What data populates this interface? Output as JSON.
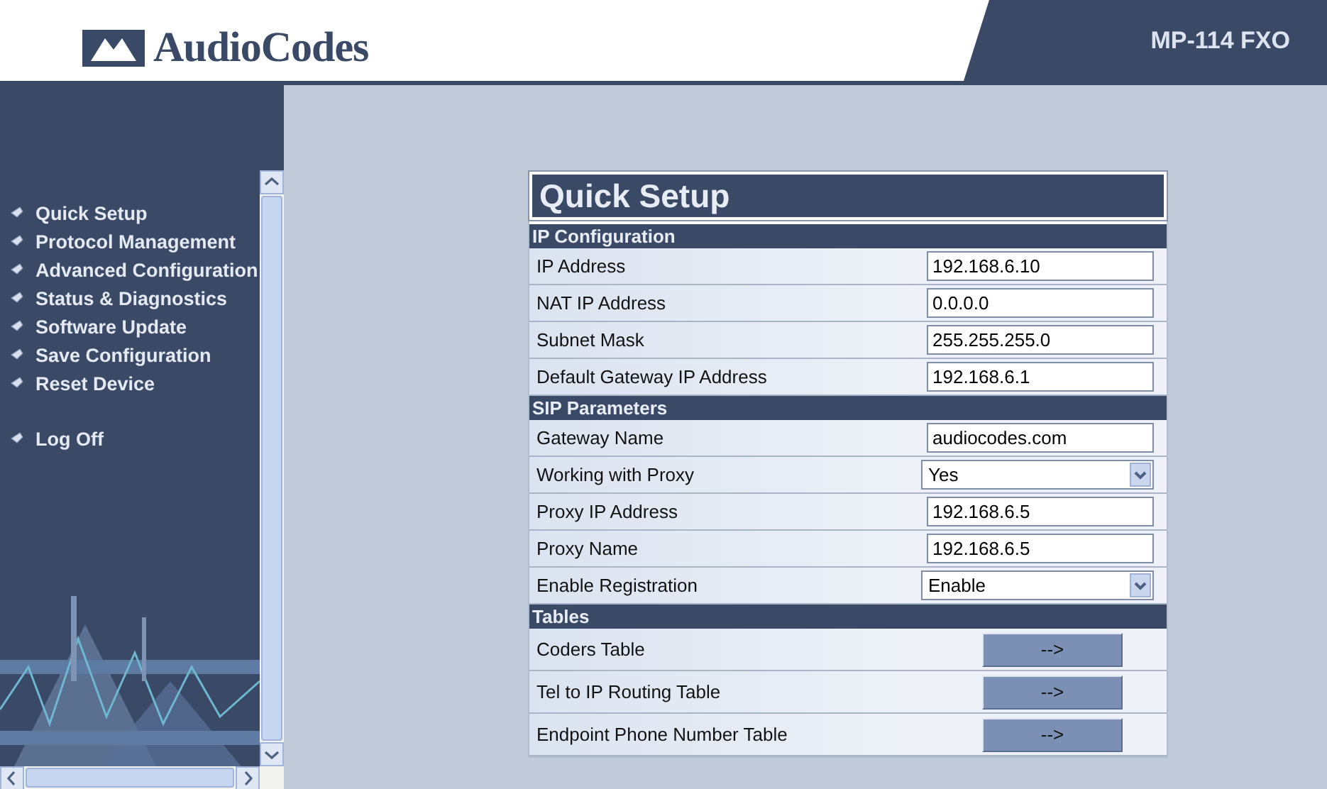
{
  "header": {
    "logo_text": "AudioCodes",
    "product": "MP-114 FXO"
  },
  "menu": [
    {
      "label": "Quick Setup"
    },
    {
      "label": "Protocol Management"
    },
    {
      "label": "Advanced Configuration"
    },
    {
      "label": "Status & Diagnostics"
    },
    {
      "label": "Software Update"
    },
    {
      "label": "Save Configuration"
    },
    {
      "label": "Reset Device"
    }
  ],
  "menu_bottom": [
    {
      "label": "Log Off"
    }
  ],
  "panel": {
    "title": "Quick Setup",
    "sections": [
      {
        "title": "IP Configuration",
        "rows": [
          {
            "kind": "input",
            "label": "IP Address",
            "value": "192.168.6.10"
          },
          {
            "kind": "input",
            "label": "NAT IP Address",
            "value": "0.0.0.0"
          },
          {
            "kind": "input",
            "label": "Subnet Mask",
            "value": "255.255.255.0"
          },
          {
            "kind": "input",
            "label": "Default Gateway IP Address",
            "value": "192.168.6.1"
          }
        ]
      },
      {
        "title": "SIP Parameters",
        "rows": [
          {
            "kind": "input",
            "label": "Gateway Name",
            "value": "audiocodes.com"
          },
          {
            "kind": "select",
            "label": "Working with Proxy",
            "value": "Yes"
          },
          {
            "kind": "input",
            "label": "Proxy IP Address",
            "value": "192.168.6.5"
          },
          {
            "kind": "input",
            "label": "Proxy Name",
            "value": "192.168.6.5"
          },
          {
            "kind": "select",
            "label": "Enable Registration",
            "value": "Enable"
          }
        ]
      },
      {
        "title": "Tables",
        "rows": [
          {
            "kind": "button",
            "label": "Coders Table",
            "value": "-->"
          },
          {
            "kind": "button",
            "label": "Tel to IP Routing Table",
            "value": "-->"
          },
          {
            "kind": "button",
            "label": "Endpoint Phone Number Table",
            "value": "-->"
          }
        ]
      }
    ]
  }
}
